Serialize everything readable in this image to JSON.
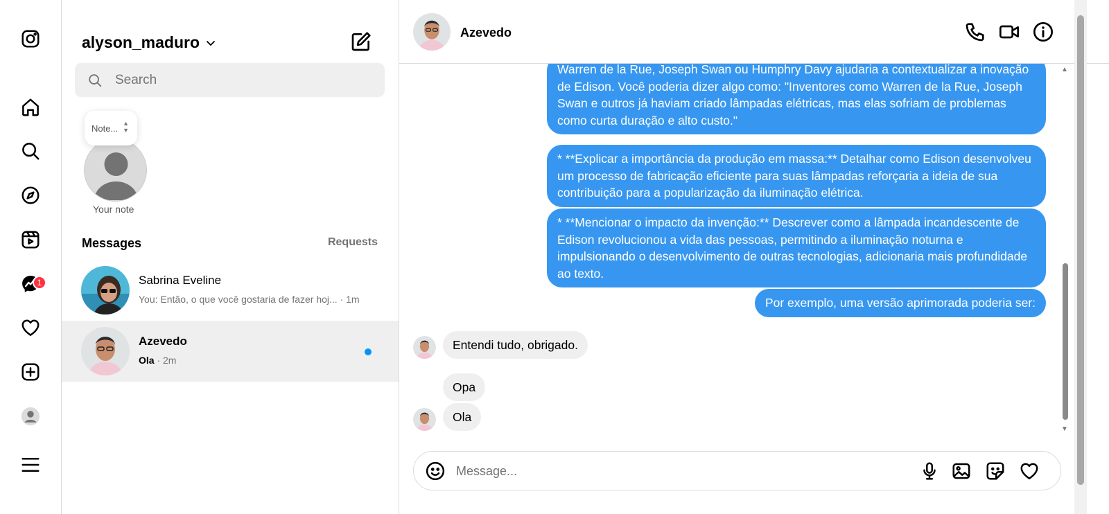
{
  "account": {
    "username": "alyson_maduro"
  },
  "search": {
    "placeholder": "Search"
  },
  "note": {
    "bubble_text": "Note...",
    "label": "Your note"
  },
  "messages_section": {
    "title": "Messages",
    "requests_label": "Requests"
  },
  "nav": {
    "messenger_badge": "1"
  },
  "threads": [
    {
      "name": "Sabrina Eveline",
      "preview": "You: Então, o que você gostaria de fazer hoj...",
      "time": "· 1m"
    },
    {
      "name": "Azevedo",
      "preview": "Ola",
      "time": "· 2m",
      "unread": true
    }
  ],
  "chat": {
    "contact_name": "Azevedo",
    "composer_placeholder": "Message...",
    "messages": [
      {
        "from": "me",
        "text": "Warren de la Rue, Joseph Swan ou Humphry Davy ajudaria a contextualizar a inovação de Edison.  Você poderia dizer algo como: \"Inventores como Warren de la Rue, Joseph Swan e outros já haviam criado lâmpadas elétricas, mas elas sofriam de problemas como curta duração e alto custo.\""
      },
      {
        "from": "me",
        "text": "* **Explicar a importância da produção em massa:**  Detalhar como Edison desenvolveu um processo de fabricação eficiente para suas lâmpadas reforçaria a ideia de sua contribuição para a popularização da iluminação elétrica."
      },
      {
        "from": "me",
        "text": "* **Mencionar o impacto da invenção:**  Descrever como a lâmpada incandescente de Edison revolucionou a vida das pessoas, permitindo a iluminação noturna e impulsionando o desenvolvimento de outras tecnologias, adicionaria mais profundidade ao texto."
      },
      {
        "from": "me",
        "text": "Por exemplo, uma versão aprimorada poderia ser:"
      },
      {
        "from": "them",
        "text": "Entendi tudo, obrigado."
      },
      {
        "from": "them",
        "text": "Opa"
      },
      {
        "from": "them",
        "text": "Ola"
      }
    ]
  },
  "colors": {
    "accent": "#3797f0",
    "unread_dot": "#0095f6",
    "badge": "#ff3040",
    "incoming_bubble": "#efefef"
  }
}
